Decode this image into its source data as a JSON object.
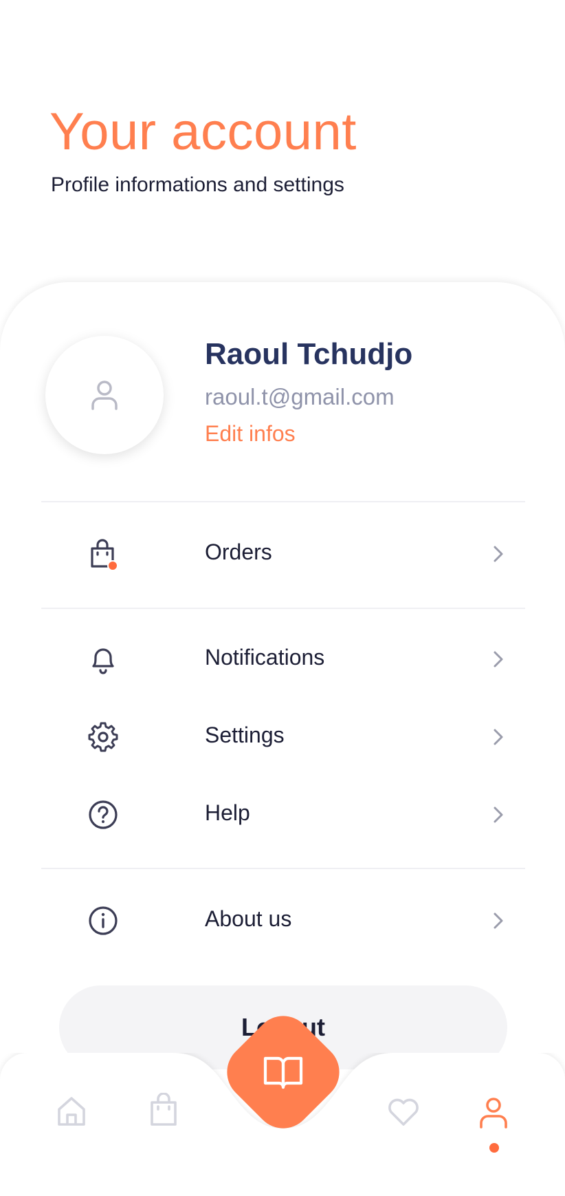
{
  "header": {
    "title": "Your account",
    "subtitle": "Profile informations and settings"
  },
  "profile": {
    "name": "Raoul Tchudjo",
    "email": "raoul.t@gmail.com",
    "edit_label": "Edit infos",
    "avatar_icon": "user-icon"
  },
  "menu": {
    "items": [
      {
        "label": "Orders",
        "icon": "shopping-bag-icon",
        "badge": true
      },
      {
        "label": "Notifications",
        "icon": "bell-icon"
      },
      {
        "label": "Settings",
        "icon": "gear-icon"
      },
      {
        "label": "Help",
        "icon": "help-circle-icon"
      },
      {
        "label": "About us",
        "icon": "info-icon"
      }
    ]
  },
  "logout": {
    "label": "Logout"
  },
  "bottom_nav": {
    "items": [
      {
        "icon": "home-icon",
        "active": false
      },
      {
        "icon": "shopping-bag-icon",
        "active": false
      },
      {
        "icon": "book-open-icon",
        "center": true
      },
      {
        "icon": "heart-icon",
        "active": false
      },
      {
        "icon": "user-icon",
        "active": true
      }
    ]
  },
  "colors": {
    "accent": "#ff7f4f",
    "text_dark": "#1c1e35",
    "name": "#27335f",
    "muted": "#8f93aa",
    "inactive_icon": "#d4d5de"
  }
}
